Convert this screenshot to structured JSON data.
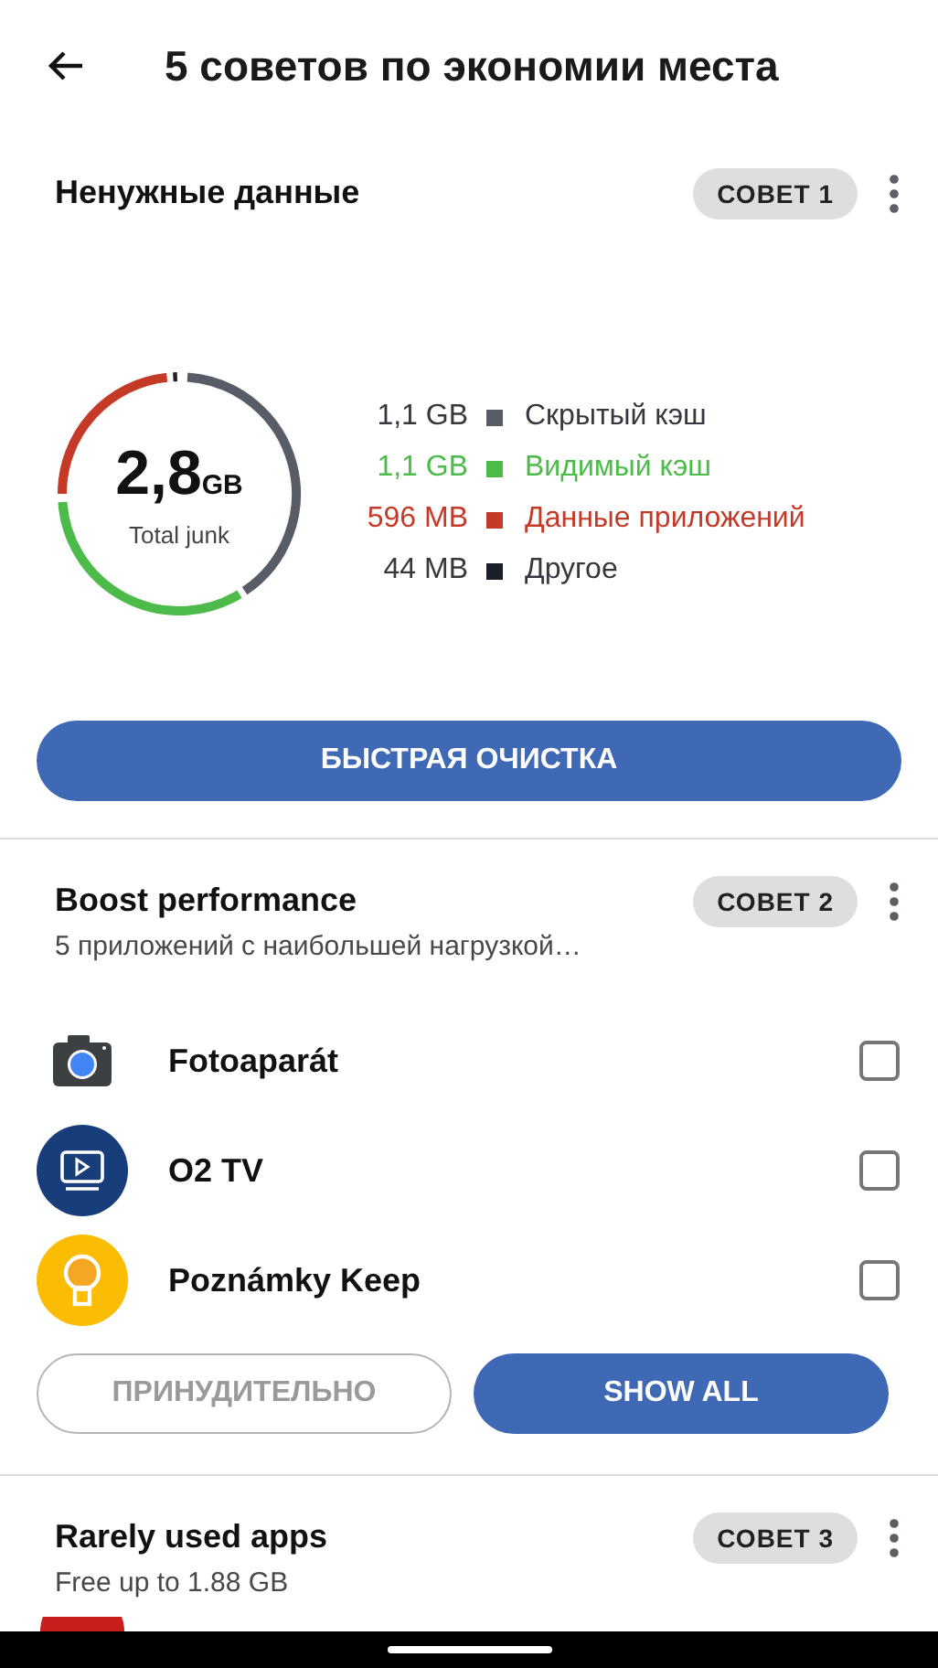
{
  "header": {
    "title": "5 советов по экономии места"
  },
  "junk": {
    "title": "Ненужные данные",
    "badge": "СОВЕТ 1",
    "total": "2,8",
    "unit": "GB",
    "total_label": "Total junk",
    "legend": [
      {
        "kind": "plain",
        "size": "1,1 GB",
        "label": "Скрытый кэш",
        "color": "#585c66"
      },
      {
        "kind": "tinted",
        "size": "1,1 GB",
        "label": "Видимый кэш",
        "color": "#4cbb4a"
      },
      {
        "kind": "tinted",
        "size": "596 MB",
        "label": "Данные приложений",
        "color": "#c53a27"
      },
      {
        "kind": "plain",
        "size": "44 MB",
        "label": "Другое",
        "color": "#1b1f27"
      }
    ],
    "button": "БЫСТРАЯ ОЧИСТКА"
  },
  "boost": {
    "title": "Boost performance",
    "badge": "СОВЕТ 2",
    "subtitle": "5 приложений с наибольшей нагрузкой…",
    "apps": [
      {
        "kind": "camera",
        "name": "Fotoaparát",
        "checked": false
      },
      {
        "kind": "tv",
        "name": "O2 TV",
        "checked": false
      },
      {
        "kind": "bulb",
        "name": "Poznámky Keep",
        "checked": false
      }
    ],
    "buttons": [
      {
        "label": "ПРИНУДИТЕЛЬНО",
        "disabled": true
      },
      {
        "label": "SHOW ALL",
        "disabled": false
      }
    ]
  },
  "rare": {
    "title": "Rarely used apps",
    "badge": "СОВЕТ 3",
    "subtitle": "Free up to 1.88 GB"
  }
}
